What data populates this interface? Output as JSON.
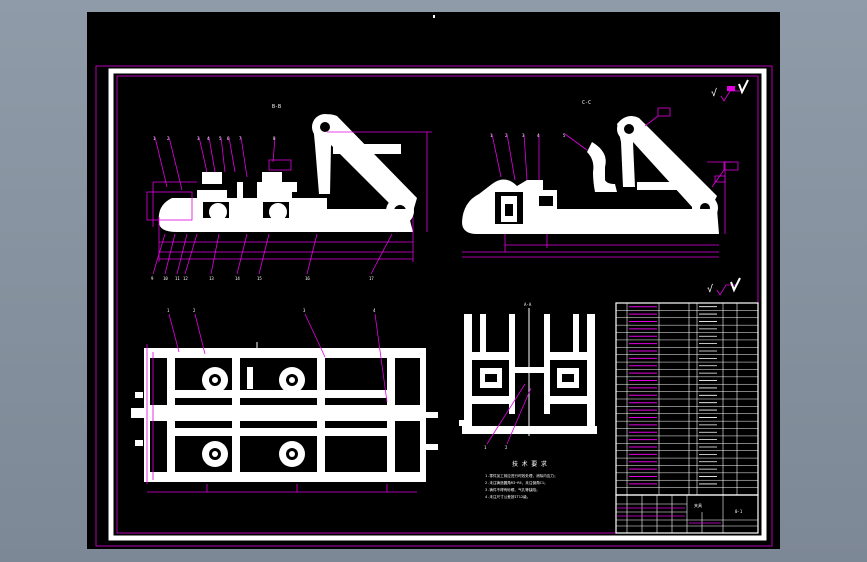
{
  "app": {
    "title": ""
  },
  "drawing": {
    "view_labels": {
      "left_view": "B-B",
      "right_view": "C-C",
      "section_view": "A-A"
    },
    "roughness_symbols": [
      "√",
      "√",
      "√"
    ],
    "notes_title": "技 术 要 求",
    "notes": [
      "1.零件加工前应进行时效处理，消除内应力；",
      "2.未注铸造圆角R3~R5，未注倒角C1；",
      "3.铸件不得有砂眼、气孔等缺陷；",
      "4.未注尺寸公差按IT12级。"
    ],
    "title_block": {
      "name": "夹具",
      "code": "0-1"
    }
  },
  "colors": {
    "background": "#000000",
    "geometry": "#ffffff",
    "annotation": "#e000e0",
    "chrome": "#8f9ba8"
  }
}
